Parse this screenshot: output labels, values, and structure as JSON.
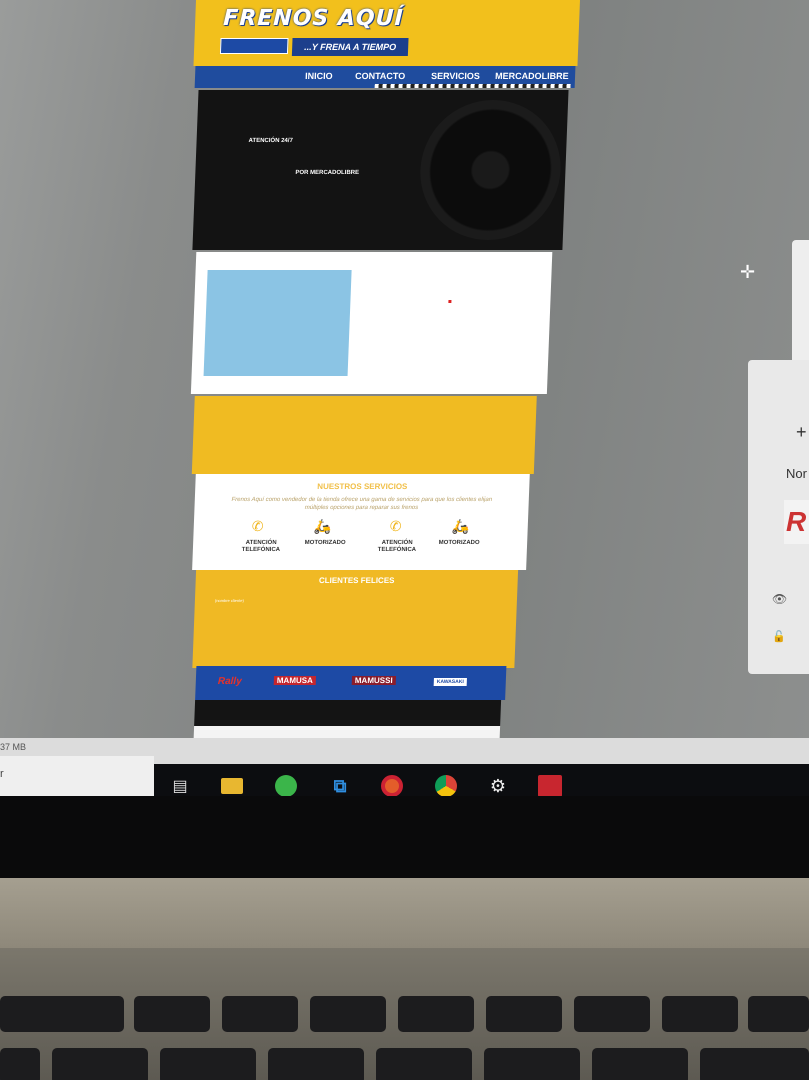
{
  "website": {
    "logo_title": "FRENOS AQUÍ",
    "logo_slogan": "...Y FRENA A TIEMPO",
    "nav": [
      "INICIO",
      "CONTACTO",
      "SERVICIOS",
      "MERCADOLIBRE"
    ],
    "hero_line1": "ATENCIÓN 24/7",
    "hero_line2": "POR MERCADOLIBRE",
    "services_title": "NUESTROS SERVICIOS",
    "services_desc": "Frenos Aquí como vendedor de la tienda ofrece una gama de servicios para que los clientes elijan múltiples opciones para reparar sus frenos",
    "services": [
      {
        "icon": "phone-icon",
        "label": "ATENCIÓN TELEFÓNICA"
      },
      {
        "icon": "scooter-icon",
        "label": "MOTORIZADO"
      },
      {
        "icon": "phone-icon",
        "label": "ATENCIÓN TELEFÓNICA"
      },
      {
        "icon": "scooter-icon",
        "label": "MOTORIZADO"
      }
    ],
    "clients_title": "CLIENTES FELICES",
    "clients_sub": "(nombre cliente)",
    "brands": [
      "Rally",
      "MAMUSA",
      "MAMUSSI",
      "KAWASAKI"
    ]
  },
  "editor": {
    "status_text": "37 MB",
    "search_text": "r",
    "panel_text": "Nor",
    "panel_plus": "+"
  },
  "taskbar": {
    "icons": [
      "task-view-icon",
      "file-explorer-icon",
      "app-green-icon",
      "vscode-icon",
      "app-orange-icon",
      "chrome-icon",
      "settings-icon",
      "app-red-icon"
    ]
  },
  "colors": {
    "brand_yellow": "#f2c01c",
    "brand_blue": "#1f4c9e",
    "hero_black": "#131313"
  }
}
